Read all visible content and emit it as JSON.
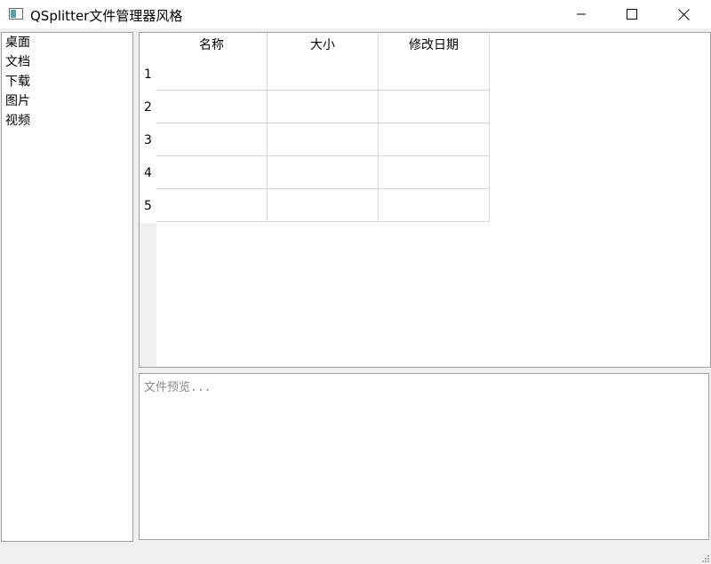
{
  "window": {
    "title": "QSplitter文件管理器风格",
    "icon": "app-window-icon",
    "controls": [
      "minimize-icon",
      "maximize-icon",
      "close-icon"
    ]
  },
  "sidebar": {
    "items": [
      {
        "label": "桌面"
      },
      {
        "label": "文档"
      },
      {
        "label": "下载"
      },
      {
        "label": "图片"
      },
      {
        "label": "视频"
      }
    ]
  },
  "table": {
    "columns": [
      "名称",
      "大小",
      "修改日期"
    ],
    "row_numbers": [
      "1",
      "2",
      "3",
      "4",
      "5"
    ],
    "rows": [
      [
        "",
        "",
        ""
      ],
      [
        "",
        "",
        ""
      ],
      [
        "",
        "",
        ""
      ],
      [
        "",
        "",
        ""
      ],
      [
        "",
        "",
        ""
      ]
    ]
  },
  "preview": {
    "placeholder": "文件预览..."
  }
}
